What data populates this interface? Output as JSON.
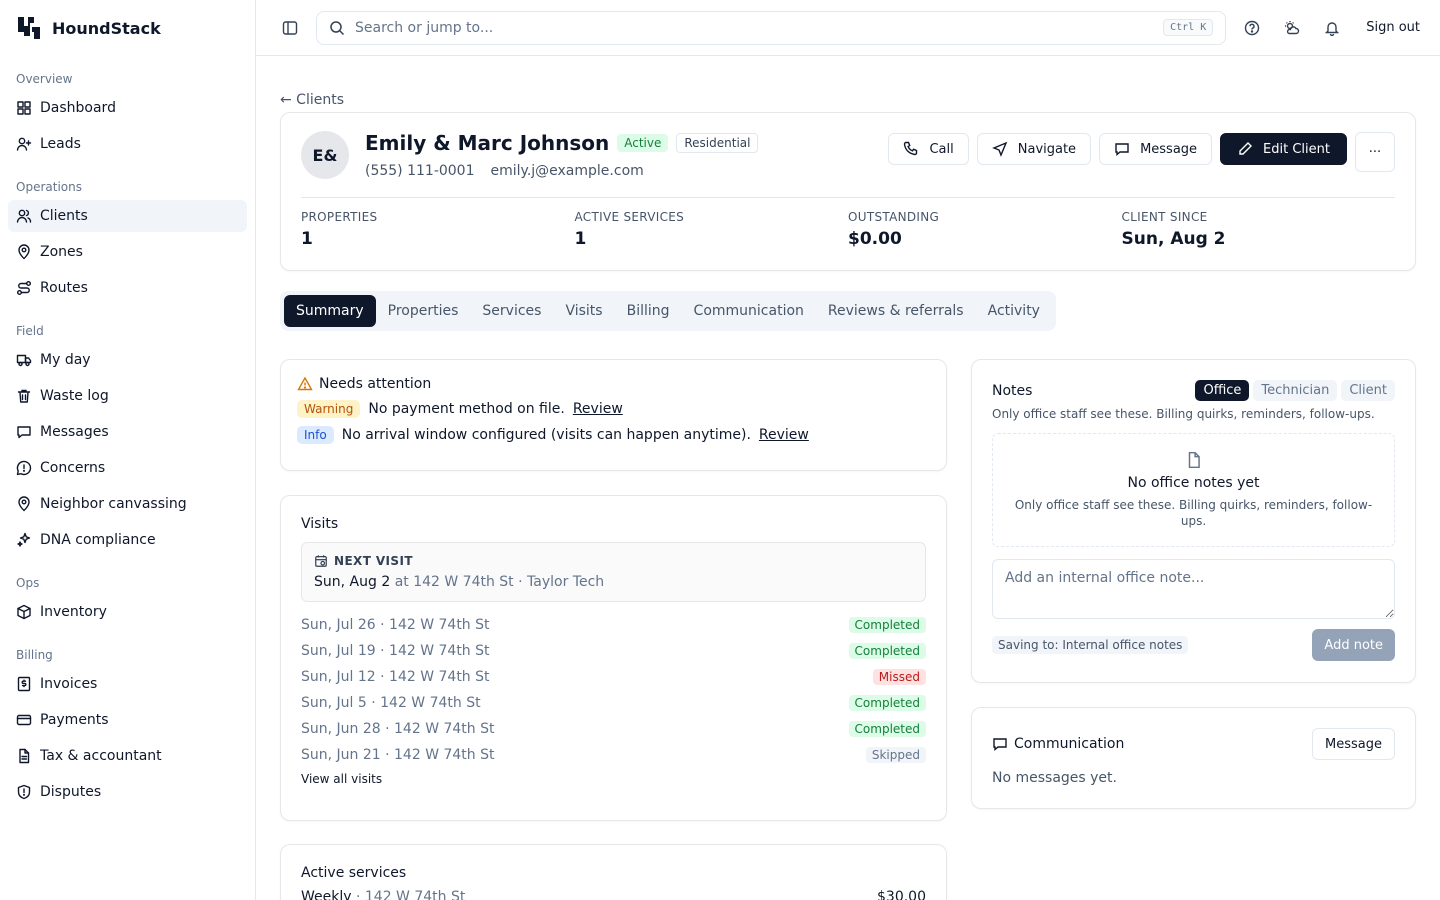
{
  "brand": {
    "name": "HoundStack"
  },
  "sidebar": {
    "sections": [
      {
        "heading": "Overview",
        "items": [
          {
            "label": "Dashboard",
            "icon": "dashboard-icon"
          },
          {
            "label": "Leads",
            "icon": "user-plus-icon"
          }
        ]
      },
      {
        "heading": "Operations",
        "items": [
          {
            "label": "Clients",
            "icon": "users-icon",
            "active": true
          },
          {
            "label": "Zones",
            "icon": "map-pin-icon"
          },
          {
            "label": "Routes",
            "icon": "route-icon"
          }
        ]
      },
      {
        "heading": "Field",
        "items": [
          {
            "label": "My day",
            "icon": "truck-icon"
          },
          {
            "label": "Waste log",
            "icon": "trash-icon"
          },
          {
            "label": "Messages",
            "icon": "message-icon"
          },
          {
            "label": "Concerns",
            "icon": "alert-circle-icon"
          },
          {
            "label": "Neighbor canvassing",
            "icon": "map-pin-icon"
          },
          {
            "label": "DNA compliance",
            "icon": "sparkle-icon"
          }
        ]
      },
      {
        "heading": "Ops",
        "items": [
          {
            "label": "Inventory",
            "icon": "package-icon"
          }
        ]
      },
      {
        "heading": "Billing",
        "items": [
          {
            "label": "Invoices",
            "icon": "invoice-icon"
          },
          {
            "label": "Payments",
            "icon": "credit-card-icon"
          },
          {
            "label": "Tax & accountant",
            "icon": "document-icon"
          },
          {
            "label": "Disputes",
            "icon": "shield-icon"
          }
        ]
      }
    ]
  },
  "topbar": {
    "search_placeholder": "Search or jump to...",
    "shortcut": "Ctrl K",
    "sign_out": "Sign out"
  },
  "breadcrumb": {
    "back": "← Clients"
  },
  "client": {
    "initials": "E&",
    "name": "Emily & Marc Johnson",
    "status": "Active",
    "type": "Residential",
    "phone": "(555) 111-0001",
    "email": "emily.j@example.com",
    "actions": {
      "call": "Call",
      "navigate": "Navigate",
      "message": "Message",
      "edit": "Edit Client",
      "more": "···"
    },
    "stats": [
      {
        "label": "PROPERTIES",
        "value": "1"
      },
      {
        "label": "ACTIVE SERVICES",
        "value": "1"
      },
      {
        "label": "OUTSTANDING",
        "value": "$0.00"
      },
      {
        "label": "CLIENT SINCE",
        "value": "Sun, Aug 2"
      }
    ]
  },
  "tabs": [
    "Summary",
    "Properties",
    "Services",
    "Visits",
    "Billing",
    "Communication",
    "Reviews & referrals",
    "Activity"
  ],
  "attention": {
    "title": "Needs attention",
    "items": [
      {
        "level": "Warning",
        "text": "No payment method on file.",
        "link": "Review"
      },
      {
        "level": "Info",
        "text": "No arrival window configured (visits can happen anytime).",
        "link": "Review"
      }
    ]
  },
  "visits": {
    "title": "Visits",
    "next_label": "NEXT VISIT",
    "next_date": "Sun, Aug 2",
    "next_detail": "at 142 W 74th St · Taylor Tech",
    "list": [
      {
        "text": "Sun, Jul 26 · 142 W 74th St",
        "status": "Completed"
      },
      {
        "text": "Sun, Jul 19 · 142 W 74th St",
        "status": "Completed"
      },
      {
        "text": "Sun, Jul 12 · 142 W 74th St",
        "status": "Missed"
      },
      {
        "text": "Sun, Jul 5 · 142 W 74th St",
        "status": "Completed"
      },
      {
        "text": "Sun, Jun 28 · 142 W 74th St",
        "status": "Completed"
      },
      {
        "text": "Sun, Jun 21 · 142 W 74th St",
        "status": "Skipped"
      }
    ],
    "view_all": "View all visits"
  },
  "services": {
    "title": "Active services",
    "row_name": "Weekly",
    "row_location": "· 142 W 74th St",
    "row_price": "$30.00"
  },
  "notes": {
    "title": "Notes",
    "tabs": [
      "Office",
      "Technician",
      "Client"
    ],
    "subtitle": "Only office staff see these. Billing quirks, reminders, follow-ups.",
    "empty_title": "No office notes yet",
    "empty_sub": "Only office staff see these. Billing quirks, reminders, follow-ups.",
    "placeholder": "Add an internal office note...",
    "saving_to": "Saving to: Internal office notes",
    "add_button": "Add note"
  },
  "communication": {
    "title": "Communication",
    "button": "Message",
    "empty": "No messages yet."
  },
  "colors": {
    "accent": "#0f172a",
    "success": "#15803d",
    "danger": "#b91c1c",
    "warning": "#b45309"
  }
}
